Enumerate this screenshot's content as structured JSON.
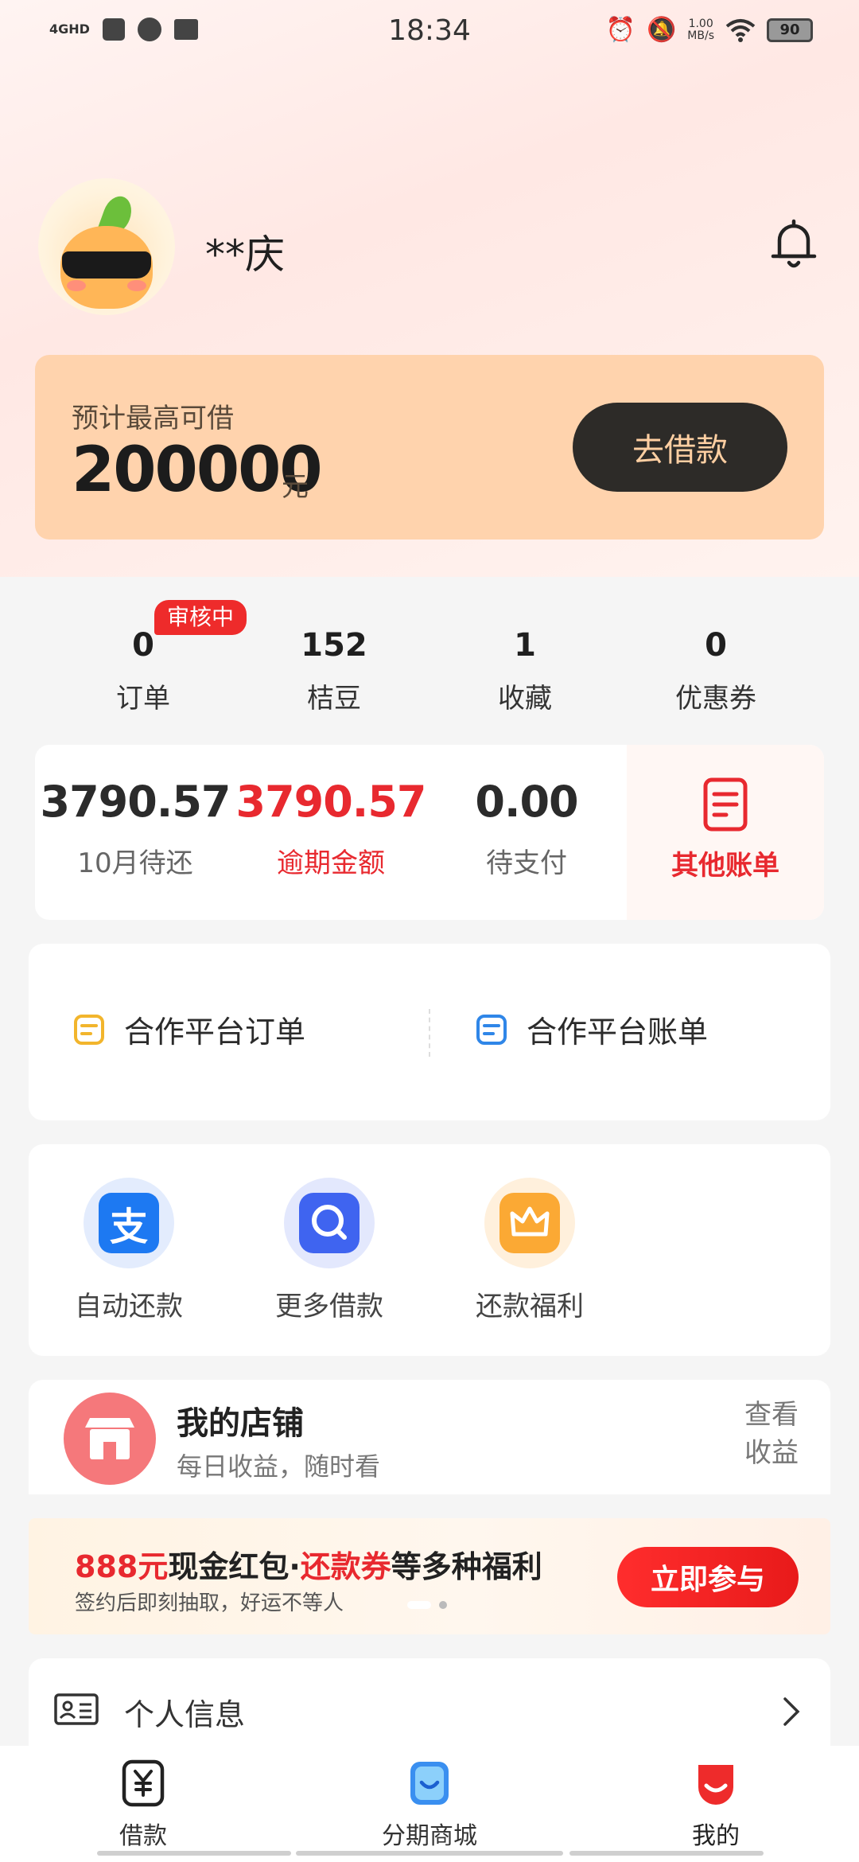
{
  "status_bar": {
    "time": "18:34",
    "network": "4GHD",
    "speed_value": "1.00",
    "speed_unit": "MB/s",
    "battery": "90"
  },
  "profile": {
    "username": "**庆",
    "bell_icon": "bell-icon"
  },
  "loan": {
    "label": "预计最高可借",
    "amount": "200000",
    "unit": "元",
    "button": "去借款"
  },
  "stats": [
    {
      "value": "0",
      "label": "订单"
    },
    {
      "value": "152",
      "label": "桔豆"
    },
    {
      "value": "1",
      "label": "收藏"
    },
    {
      "value": "0",
      "label": "优惠券"
    }
  ],
  "order_badge": "审核中",
  "bills": {
    "items": [
      {
        "value": "3790.57",
        "label": "10月待还"
      },
      {
        "value": "3790.57",
        "label": "逾期金额"
      },
      {
        "value": "0.00",
        "label": "待支付"
      }
    ],
    "other": "其他账单"
  },
  "partner": {
    "orders": "合作平台订单",
    "bills": "合作平台账单"
  },
  "actions": [
    {
      "label": "自动还款",
      "icon": "alipay-icon"
    },
    {
      "label": "更多借款",
      "icon": "search-icon"
    },
    {
      "label": "还款福利",
      "icon": "crown-icon"
    }
  ],
  "shop": {
    "title": "我的店铺",
    "subtitle": "每日收益，随时看",
    "view_line1": "查看",
    "view_line2": "收益"
  },
  "banner": {
    "title_part1": "888元",
    "title_part2": "现金红包·",
    "title_part3": "还款券",
    "title_part4": "等多种福利",
    "subtitle": "签约后即刻抽取，好运不等人",
    "button": "立即参与"
  },
  "info": {
    "label": "个人信息"
  },
  "bottom_nav": [
    {
      "label": "借款",
      "icon": "yuan-icon"
    },
    {
      "label": "分期商城",
      "icon": "mall-icon"
    },
    {
      "label": "我的",
      "icon": "profile-icon"
    }
  ],
  "colors": {
    "accent_red": "#e8292f",
    "loan_card": "#ffd3ad",
    "loan_button": "#2d2b28"
  }
}
